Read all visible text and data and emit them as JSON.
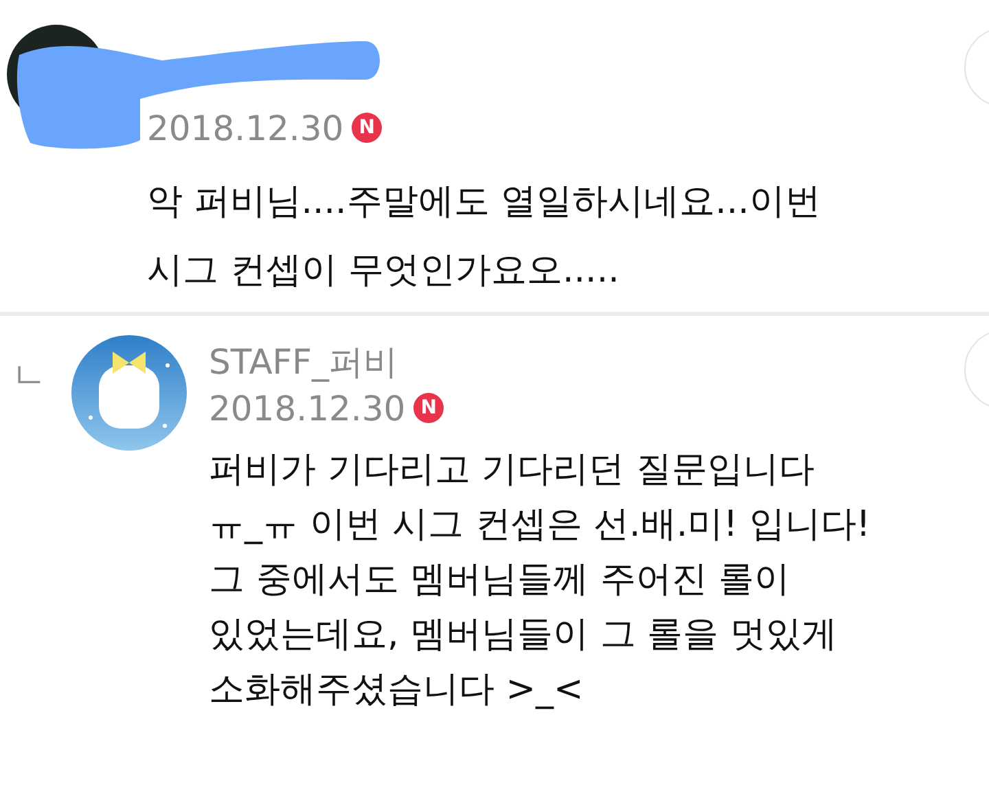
{
  "comments": [
    {
      "kind": "comment",
      "author_redacted": true,
      "date": "2018.12.30",
      "is_new": true,
      "new_badge": "N",
      "body": "악 퍼비님....주말에도 열일하시네요...이번\n시그 컨셉이 무엇인가요오....."
    },
    {
      "kind": "reply",
      "reply_mark": "ㄴ",
      "author": "STAFF_퍼비",
      "date": "2018.12.30",
      "is_new": true,
      "new_badge": "N",
      "body": "퍼비가 기다리고 기다리던 질문입니다\nㅠ_ㅠ 이번 시그 컨셉은 선.배.미! 입니다!\n그 중에서도 멤버님들께 주어진 롤이\n있었는데요, 멤버님들이 그 롤을 멋있게\n소화해주셨습니다 >_<"
    }
  ]
}
